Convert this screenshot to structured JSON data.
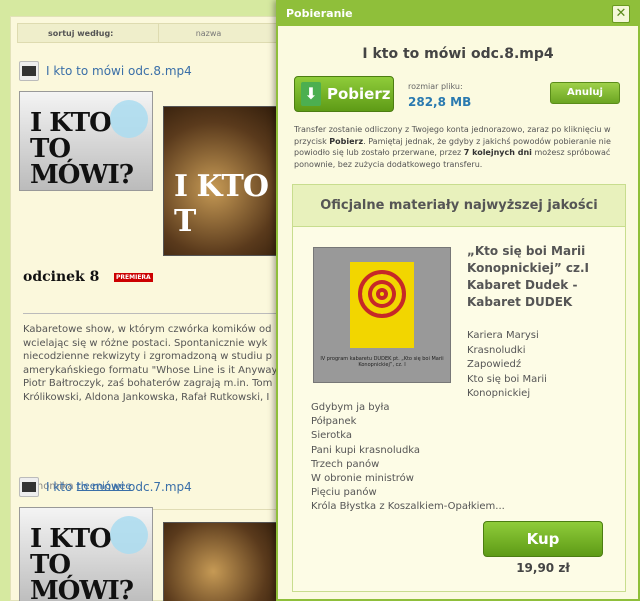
{
  "background": {
    "sort_label": "sortuj według:",
    "sort_column": "nazwa",
    "items": [
      {
        "title": "I kto to mówi odc.8.mp4",
        "thumb_text": "I KTO TO MÓWI?",
        "thumb2_text": "I KTO T",
        "episode": "odcinek 8",
        "badge": "PREMIERA",
        "description_lines": [
          "Kabaretowe show, w którym czwórka komików od",
          "wcielając się w różne postaci. Spontanicznie wyk",
          "niecodzienne rekwizyty i zgromadzoną w studiu p",
          "amerykańskiego formatu \"Whose Line is it Anyway",
          "Piotr Bałtroczyk, zaś bohaterów zagrają m.in. Tom",
          "Królikowski, Aldona Jankowska, Rafał Rutkowski, I"
        ],
        "folder_prefix": "z chomika",
        "folder_link": "tleeniowee"
      },
      {
        "title": "I kto to mówi odc.7.mp4",
        "thumb_text": "I KTO TO MÓWI?"
      }
    ]
  },
  "dialog": {
    "title": "Pobieranie",
    "close_symbol": "✕",
    "file_title": "I kto to mówi odc.8.mp4",
    "download_label": "Pobierz",
    "size_label": "rozmiar pliku:",
    "size_value": "282,8 MB",
    "cancel_label": "Anuluj",
    "note_part1": "Transfer zostanie odliczony z Twojego konta jednorazowo, zaraz po kliknięciu w przycisk ",
    "note_bold1": "Pobierz",
    "note_part2": ". Pamiętaj jednak, że gdyby z jakichś powodów pobieranie nie powiodło się lub zostało przerwane, przez ",
    "note_bold2": "7 kolejnych dni",
    "note_part3": " możesz spróbować ponownie, bez zużycia dodatkowego transferu.",
    "promo_header": "Oficjalne materiały najwyższej jakości",
    "cover_caption": "IV program kabaretu DUDEK pt. „Kto się boi Marii Konopnickiej”, cz. I",
    "product_title": "„Kto się boi Marii Konopnickiej” cz.I Kabaret Dudek - Kabaret DUDEK",
    "tracks_right": [
      "Kariera Marysi",
      "Krasnoludki",
      "Zapowiedź",
      "Kto się boi Marii",
      "Konopnickiej"
    ],
    "tracks_left": [
      "Gdybym ja była",
      "Półpanek",
      "Sierotka",
      "Pani kupi krasnoludka",
      "Trzech panów",
      "W obronie ministrów",
      "Pięciu panów",
      "Króla Błystka z Koszalkiem-Opałkiem..."
    ],
    "buy_label": "Kup",
    "price": "19,90 zł"
  },
  "colors": {
    "accent_green": "#8fbf3a",
    "link_blue": "#3a6fa8",
    "premiere_red": "#cc0000"
  }
}
